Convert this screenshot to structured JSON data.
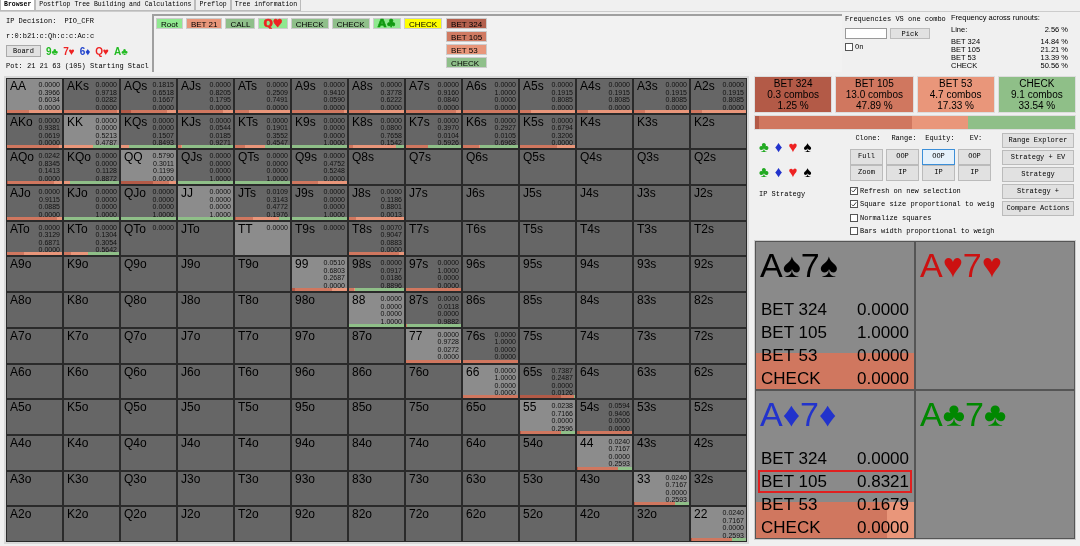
{
  "tabs": [
    {
      "label": "Browser",
      "selected": true
    },
    {
      "label": "Postflop Tree Building and Calculations",
      "selected": false
    },
    {
      "label": "Preflop",
      "selected": false
    },
    {
      "label": "Tree information",
      "selected": false
    }
  ],
  "info": {
    "decision_label": "IP Decision:",
    "solver": "PIO_CFR",
    "line": "r:0:b21:c:Qh:c:c:Ac:c",
    "board_button": "Board",
    "board": [
      {
        "card": "9♣",
        "color": "#22bb22"
      },
      {
        "card": "7♥",
        "color": "#ee2222"
      },
      {
        "card": "6♦",
        "color": "#2244cc"
      },
      {
        "card": "Q♥",
        "color": "#ee2222"
      },
      {
        "card": "A♣",
        "color": "#22bb22"
      }
    ],
    "pot": "Pot: 21 21 63 (105) Starting Stacl"
  },
  "path": [
    {
      "kind": "action",
      "label": "Root",
      "color": "#90e890",
      "selected": false
    },
    {
      "kind": "action",
      "label": "BET 21",
      "color": "#e8967a",
      "selected": false
    },
    {
      "kind": "action",
      "label": "CALL",
      "color": "#8fbf8a",
      "selected": false
    },
    {
      "kind": "card",
      "label": "Q♥",
      "color": "#ee2222",
      "selected": false
    },
    {
      "kind": "action",
      "label": "CHECK",
      "color": "#8fbf8a",
      "selected": false
    },
    {
      "kind": "action",
      "label": "CHECK",
      "color": "#8fbf8a",
      "selected": false
    },
    {
      "kind": "card",
      "label": "A♣",
      "color": "#119911",
      "selected": false
    },
    {
      "kind": "action",
      "label": "CHECK",
      "selected": true
    }
  ],
  "options": [
    {
      "label": "BET 324",
      "color": "#b3604d"
    },
    {
      "label": "BET 105",
      "color": "#d07a62"
    },
    {
      "label": "BET 53",
      "color": "#e8967a"
    },
    {
      "label": "CHECK",
      "color": "#8fbf8a"
    }
  ],
  "combo_frequencies": {
    "title": "Frequencies VS one combo",
    "pick_button": "Pick",
    "on_label": "On",
    "on": false
  },
  "runouts": {
    "title": "Frequency across runouts:",
    "line_label": "Line:",
    "line_value": "2.56 %",
    "items": [
      {
        "action": "BET 324",
        "value": "14.84 %"
      },
      {
        "action": "BET 105",
        "value": "21.21 %"
      },
      {
        "action": "BET 53",
        "value": "13.39 %"
      },
      {
        "action": "CHECK",
        "value": "50.56 %"
      }
    ]
  },
  "actions": [
    {
      "name": "BET 324",
      "combos": "0.3 combos",
      "pct": "1.25 %",
      "color": "#b35a47"
    },
    {
      "name": "BET 105",
      "combos": "13.0 combos",
      "pct": "47.89 %",
      "color": "#d0775f"
    },
    {
      "name": "BET 53",
      "combos": "4.7 combos",
      "pct": "17.33 %",
      "color": "#e9967a"
    },
    {
      "name": "CHECK",
      "combos": "9.1 combos",
      "pct": "33.54 %",
      "color": "#8fbf88"
    }
  ],
  "suit_rows": [
    [
      {
        "symbol": "♣",
        "color": "#22aa22"
      },
      {
        "symbol": "♦",
        "color": "#2233cc"
      },
      {
        "symbol": "♥",
        "color": "#ee2222"
      },
      {
        "symbol": "♠",
        "color": "#000000"
      }
    ],
    [
      {
        "symbol": "♣",
        "color": "#22aa22"
      },
      {
        "symbol": "♦",
        "color": "#2233cc"
      },
      {
        "symbol": "♥",
        "color": "#ee2222"
      },
      {
        "symbol": "♠",
        "color": "#000000"
      }
    ]
  ],
  "strategy_label": "IP Strategy",
  "column_labels": [
    "Clone:",
    "Range:",
    "Equity:",
    "EV:"
  ],
  "toggle_columns": [
    [
      {
        "label": "Full",
        "selected": false
      },
      {
        "label": "Zoom",
        "selected": false
      }
    ],
    [
      {
        "label": "OOP",
        "selected": false
      },
      {
        "label": "IP",
        "selected": false
      }
    ],
    [
      {
        "label": "OOP",
        "selected": true
      },
      {
        "label": "IP",
        "selected": false
      }
    ],
    [
      {
        "label": "OOP",
        "selected": false
      },
      {
        "label": "IP",
        "selected": false
      }
    ]
  ],
  "side_buttons": [
    "Range Explorer",
    "Strategy + EV",
    "Strategy",
    "Strategy +",
    "Compare Actions"
  ],
  "options_checks": [
    {
      "label": "Refresh on new selection",
      "checked": true
    },
    {
      "label": "Square size proportional to weig",
      "checked": true
    },
    {
      "label": "Normalize squares",
      "checked": false
    },
    {
      "label": "Bars width proportional to weigh",
      "checked": false
    }
  ],
  "combos": [
    {
      "cards": "A♠7♠",
      "color": "#000000",
      "rows": [
        {
          "action": "BET 324",
          "value": "0.0000",
          "highlighted": false
        },
        {
          "action": "BET 105",
          "value": "1.0000",
          "highlighted": false
        },
        {
          "action": "BET 53",
          "value": "0.0000",
          "highlighted": false
        },
        {
          "action": "CHECK",
          "value": "0.0000",
          "highlighted": false
        }
      ]
    },
    {
      "cards": "A♥7♥",
      "color": "#cc1111"
    },
    {
      "cards": "A♦7♦",
      "color": "#2233cc",
      "rows": [
        {
          "action": "BET 324",
          "value": "0.0000",
          "highlighted": false
        },
        {
          "action": "BET 105",
          "value": "0.8321",
          "highlighted": true
        },
        {
          "action": "BET 53",
          "value": "0.1679",
          "highlighted": false
        },
        {
          "action": "CHECK",
          "value": "0.0000",
          "highlighted": false
        }
      ]
    },
    {
      "cards": "A♣7♣",
      "color": "#008800"
    }
  ],
  "grid": [
    [
      {
        "hand": "AA",
        "values": [
          "0.0000",
          "0.3966",
          "0.6034",
          "0.0000"
        ]
      },
      {
        "hand": "AKs",
        "values": [
          "0.0000",
          "0.9718",
          "0.0282",
          "0.0000"
        ]
      },
      {
        "hand": "AQs",
        "values": [
          "0.1815",
          "0.6518",
          "0.1667",
          "0.0000"
        ]
      },
      {
        "hand": "AJs",
        "values": [
          "0.0000",
          "0.8205",
          "0.1795",
          "0.0000"
        ]
      },
      {
        "hand": "ATs",
        "values": [
          "0.0000",
          "0.2509",
          "0.7491",
          "0.0000"
        ]
      },
      {
        "hand": "A9s",
        "values": [
          "0.0000",
          "0.9410",
          "0.0590",
          "0.0000"
        ]
      },
      {
        "hand": "A8s",
        "values": [
          "0.0000",
          "0.3778",
          "0.6222",
          "0.0000"
        ]
      },
      {
        "hand": "A7s",
        "values": [
          "0.0000",
          "0.9160",
          "0.0840",
          "0.0000"
        ]
      },
      {
        "hand": "A6s",
        "values": [
          "0.0000",
          "1.0000",
          "0.0000",
          "0.0000"
        ]
      },
      {
        "hand": "A5s",
        "values": [
          "0.0000",
          "0.1915",
          "0.8085",
          "0.0000"
        ]
      },
      {
        "hand": "A4s",
        "values": [
          "0.0000",
          "0.1915",
          "0.8085",
          "0.0000"
        ]
      },
      {
        "hand": "A3s",
        "values": [
          "0.0000",
          "0.1915",
          "0.8085",
          "0.0000"
        ]
      },
      {
        "hand": "A2s",
        "values": [
          "0.0000",
          "0.1915",
          "0.8085",
          "0.0000"
        ]
      }
    ],
    [
      {
        "hand": "AKo",
        "values": [
          "0.0000",
          "0.9381",
          "0.0619",
          "0.0000"
        ]
      },
      {
        "hand": "KK",
        "values": [
          "0.0000",
          "0.0000",
          "0.5213",
          "0.4787"
        ]
      },
      {
        "hand": "KQs",
        "values": [
          "0.0000",
          "0.0000",
          "0.1507",
          "0.8493"
        ]
      },
      {
        "hand": "KJs",
        "values": [
          "0.0000",
          "0.0544",
          "0.0185",
          "0.9271"
        ]
      },
      {
        "hand": "KTs",
        "values": [
          "0.0000",
          "0.1901",
          "0.3552",
          "0.4547"
        ]
      },
      {
        "hand": "K9s",
        "values": [
          "0.0000",
          "0.0000",
          "0.0000",
          "1.0000"
        ]
      },
      {
        "hand": "K8s",
        "values": [
          "0.0000",
          "0.0800",
          "0.7658",
          "0.1542"
        ]
      },
      {
        "hand": "K7s",
        "values": [
          "0.0000",
          "0.3970",
          "0.0104",
          "0.5926"
        ]
      },
      {
        "hand": "K6s",
        "values": [
          "0.0000",
          "0.2927",
          "0.0105",
          "0.6968"
        ]
      },
      {
        "hand": "K5s",
        "values": [
          "0.0000",
          "0.6794",
          "0.3206",
          "0.0000"
        ]
      },
      {
        "hand": "K4s"
      },
      {
        "hand": "K3s"
      },
      {
        "hand": "K2s"
      }
    ],
    [
      {
        "hand": "AQo",
        "values": [
          "0.0242",
          "0.8345",
          "0.1413",
          "0.0000"
        ]
      },
      {
        "hand": "KQo",
        "values": [
          "0.0000",
          "0.0000",
          "0.1128",
          "0.8872"
        ]
      },
      {
        "hand": "QQ",
        "values": [
          "0.5790",
          "0.3011",
          "0.1199",
          "0.0000"
        ]
      },
      {
        "hand": "QJs",
        "values": [
          "0.0000",
          "0.0000",
          "0.0000",
          "1.0000"
        ]
      },
      {
        "hand": "QTs",
        "values": [
          "0.0000",
          "0.0000",
          "0.0000",
          "1.0000"
        ]
      },
      {
        "hand": "Q9s",
        "values": [
          "0.0000",
          "0.4752",
          "0.5248",
          "0.0000"
        ]
      },
      {
        "hand": "Q8s"
      },
      {
        "hand": "Q7s"
      },
      {
        "hand": "Q6s"
      },
      {
        "hand": "Q5s"
      },
      {
        "hand": "Q4s"
      },
      {
        "hand": "Q3s"
      },
      {
        "hand": "Q2s"
      }
    ],
    [
      {
        "hand": "AJo",
        "values": [
          "0.0000",
          "0.9115",
          "0.0885",
          "0.0000"
        ]
      },
      {
        "hand": "KJo",
        "values": [
          "0.0000",
          "0.0000",
          "0.0000",
          "1.0000"
        ]
      },
      {
        "hand": "QJo",
        "values": [
          "0.0000",
          "0.0000",
          "0.0000",
          "1.0000"
        ]
      },
      {
        "hand": "JJ",
        "values": [
          "0.0000",
          "0.0000",
          "0.0000",
          "1.0000"
        ]
      },
      {
        "hand": "JTs",
        "values": [
          "0.0109",
          "0.3143",
          "0.4772",
          "0.1976"
        ]
      },
      {
        "hand": "J9s",
        "values": [
          "0.0000",
          "0.0000",
          "0.0000",
          "1.0000"
        ]
      },
      {
        "hand": "J8s",
        "values": [
          "0.0000",
          "0.1186",
          "0.8801",
          "0.0013"
        ]
      },
      {
        "hand": "J7s"
      },
      {
        "hand": "J6s"
      },
      {
        "hand": "J5s"
      },
      {
        "hand": "J4s"
      },
      {
        "hand": "J3s"
      },
      {
        "hand": "J2s"
      }
    ],
    [
      {
        "hand": "ATo",
        "values": [
          "0.0000",
          "0.3129",
          "0.6871",
          "0.0000"
        ]
      },
      {
        "hand": "KTo",
        "values": [
          "0.0000",
          "0.1304",
          "0.3054",
          "0.5642"
        ]
      },
      {
        "hand": "QTo",
        "values": [
          "0.0000"
        ]
      },
      {
        "hand": "JTo"
      },
      {
        "hand": "TT",
        "values": [
          "0.0000"
        ]
      },
      {
        "hand": "T9s",
        "values": [
          "0.0000"
        ]
      },
      {
        "hand": "T8s",
        "values": [
          "0.0070",
          "0.9047",
          "0.0883",
          "0.0000"
        ]
      },
      {
        "hand": "T7s"
      },
      {
        "hand": "T6s"
      },
      {
        "hand": "T5s"
      },
      {
        "hand": "T4s"
      },
      {
        "hand": "T3s"
      },
      {
        "hand": "T2s"
      }
    ],
    [
      {
        "hand": "A9o"
      },
      {
        "hand": "K9o"
      },
      {
        "hand": "Q9o"
      },
      {
        "hand": "J9o"
      },
      {
        "hand": "T9o"
      },
      {
        "hand": "99",
        "values": [
          "0.0510",
          "0.6803",
          "0.2687",
          "0.0000"
        ]
      },
      {
        "hand": "98s",
        "values": [
          "0.0000",
          "0.0917",
          "0.0186",
          "0.8896"
        ]
      },
      {
        "hand": "97s",
        "values": [
          "0.0000",
          "1.0000",
          "0.0000",
          "0.0000"
        ]
      },
      {
        "hand": "96s"
      },
      {
        "hand": "95s"
      },
      {
        "hand": "94s"
      },
      {
        "hand": "93s"
      },
      {
        "hand": "92s"
      }
    ],
    [
      {
        "hand": "A8o"
      },
      {
        "hand": "K8o"
      },
      {
        "hand": "Q8o"
      },
      {
        "hand": "J8o"
      },
      {
        "hand": "T8o"
      },
      {
        "hand": "98o"
      },
      {
        "hand": "88",
        "values": [
          "0.0000",
          "0.0000",
          "0.0000",
          "1.0000"
        ]
      },
      {
        "hand": "87s",
        "values": [
          "0.0000",
          "0.0118",
          "0.0000",
          "0.9882"
        ]
      },
      {
        "hand": "86s"
      },
      {
        "hand": "85s"
      },
      {
        "hand": "84s"
      },
      {
        "hand": "83s"
      },
      {
        "hand": "82s"
      }
    ],
    [
      {
        "hand": "A7o"
      },
      {
        "hand": "K7o"
      },
      {
        "hand": "Q7o"
      },
      {
        "hand": "J7o"
      },
      {
        "hand": "T7o"
      },
      {
        "hand": "97o"
      },
      {
        "hand": "87o"
      },
      {
        "hand": "77",
        "values": [
          "0.0000",
          "0.9728",
          "0.0272",
          "0.0000"
        ]
      },
      {
        "hand": "76s",
        "values": [
          "0.0000",
          "1.0000",
          "0.0000",
          "0.0000"
        ]
      },
      {
        "hand": "75s"
      },
      {
        "hand": "74s"
      },
      {
        "hand": "73s"
      },
      {
        "hand": "72s"
      }
    ],
    [
      {
        "hand": "A6o"
      },
      {
        "hand": "K6o"
      },
      {
        "hand": "Q6o"
      },
      {
        "hand": "J6o"
      },
      {
        "hand": "T6o"
      },
      {
        "hand": "96o"
      },
      {
        "hand": "86o"
      },
      {
        "hand": "76o"
      },
      {
        "hand": "66",
        "values": [
          "0.0000",
          "1.0000",
          "0.0000",
          "0.0000"
        ]
      },
      {
        "hand": "65s",
        "values": [
          "0.7387",
          "0.2487",
          "0.0000",
          "0.0126"
        ]
      },
      {
        "hand": "64s"
      },
      {
        "hand": "63s"
      },
      {
        "hand": "62s"
      }
    ],
    [
      {
        "hand": "A5o"
      },
      {
        "hand": "K5o"
      },
      {
        "hand": "Q5o"
      },
      {
        "hand": "J5o"
      },
      {
        "hand": "T5o"
      },
      {
        "hand": "95o"
      },
      {
        "hand": "85o"
      },
      {
        "hand": "75o"
      },
      {
        "hand": "65o"
      },
      {
        "hand": "55",
        "values": [
          "0.0238",
          "0.7166",
          "0.0000",
          "0.2596"
        ]
      },
      {
        "hand": "54s",
        "values": [
          "0.0594",
          "0.9406",
          "0.0000",
          "0.0000"
        ]
      },
      {
        "hand": "53s"
      },
      {
        "hand": "52s"
      }
    ],
    [
      {
        "hand": "A4o"
      },
      {
        "hand": "K4o"
      },
      {
        "hand": "Q4o"
      },
      {
        "hand": "J4o"
      },
      {
        "hand": "T4o"
      },
      {
        "hand": "94o"
      },
      {
        "hand": "84o"
      },
      {
        "hand": "74o"
      },
      {
        "hand": "64o"
      },
      {
        "hand": "54o"
      },
      {
        "hand": "44",
        "values": [
          "0.0240",
          "0.7167",
          "0.0000",
          "0.2593"
        ]
      },
      {
        "hand": "43s"
      },
      {
        "hand": "42s"
      }
    ],
    [
      {
        "hand": "A3o"
      },
      {
        "hand": "K3o"
      },
      {
        "hand": "Q3o"
      },
      {
        "hand": "J3o"
      },
      {
        "hand": "T3o"
      },
      {
        "hand": "93o"
      },
      {
        "hand": "83o"
      },
      {
        "hand": "73o"
      },
      {
        "hand": "63o"
      },
      {
        "hand": "53o"
      },
      {
        "hand": "43o"
      },
      {
        "hand": "33",
        "values": [
          "0.0240",
          "0.7167",
          "0.0000",
          "0.2593"
        ]
      },
      {
        "hand": "32s"
      }
    ],
    [
      {
        "hand": "A2o"
      },
      {
        "hand": "K2o"
      },
      {
        "hand": "Q2o"
      },
      {
        "hand": "J2o"
      },
      {
        "hand": "T2o"
      },
      {
        "hand": "92o"
      },
      {
        "hand": "82o"
      },
      {
        "hand": "72o"
      },
      {
        "hand": "62o"
      },
      {
        "hand": "52o"
      },
      {
        "hand": "42o"
      },
      {
        "hand": "32o"
      },
      {
        "hand": "22",
        "values": [
          "0.0240",
          "0.7167",
          "0.0000",
          "0.2593"
        ]
      }
    ]
  ]
}
